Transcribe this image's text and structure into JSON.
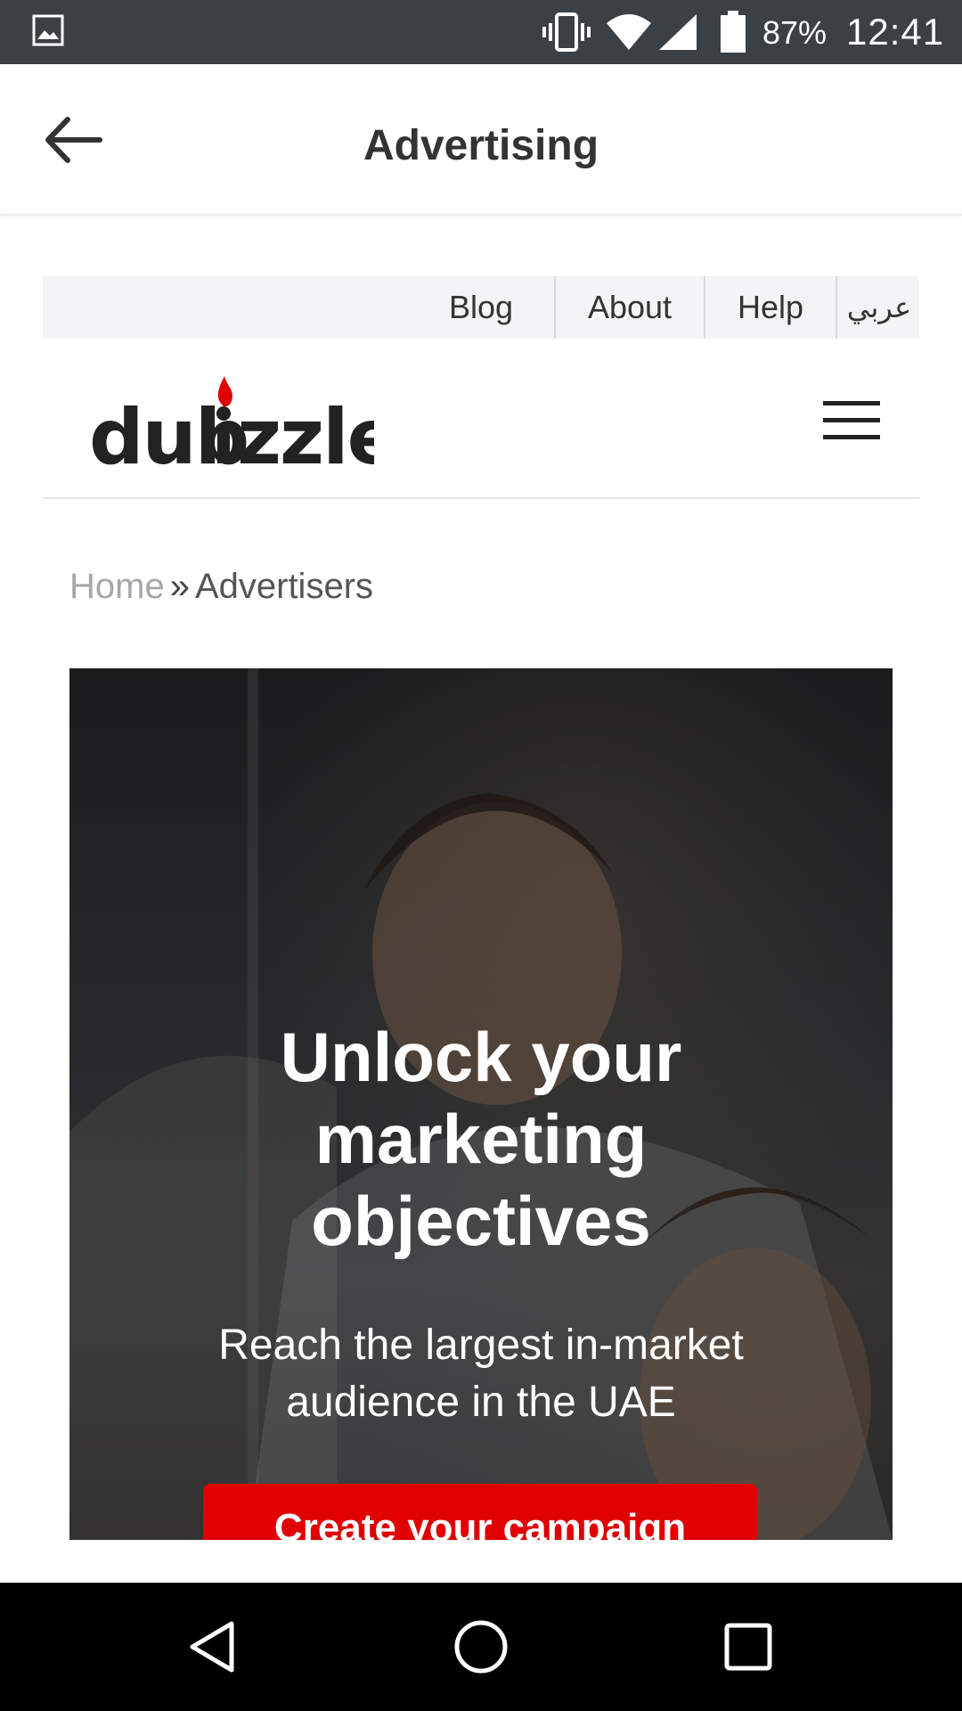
{
  "status_bar": {
    "battery_percent": "87%",
    "time": "12:41",
    "icons": [
      "gallery-icon",
      "vibrate-icon",
      "wifi-icon",
      "signal-icon",
      "battery-icon"
    ]
  },
  "app_bar": {
    "title": "Advertising",
    "back_icon": "arrow-left-icon"
  },
  "top_links": {
    "blog": "Blog",
    "about": "About",
    "help": "Help",
    "arabic": "عربي"
  },
  "header": {
    "logo_text": "dubizzle",
    "menu_icon": "hamburger-menu-icon"
  },
  "breadcrumb": {
    "home": "Home",
    "separator": "»",
    "current": "Advertisers"
  },
  "hero": {
    "title_line1": "Unlock your",
    "title_line2": "marketing",
    "title_line3": "objectives",
    "subtitle_line1": "Reach the largest in-market",
    "subtitle_line2": "audience in the UAE",
    "cta_label": "Create your campaign"
  },
  "colors": {
    "status_bar": "#3b4044",
    "brand_red": "#e00000",
    "nav_bar": "#000000"
  },
  "nav_bar": {
    "icons": [
      "back-triangle-icon",
      "home-circle-icon",
      "recents-square-icon"
    ]
  }
}
